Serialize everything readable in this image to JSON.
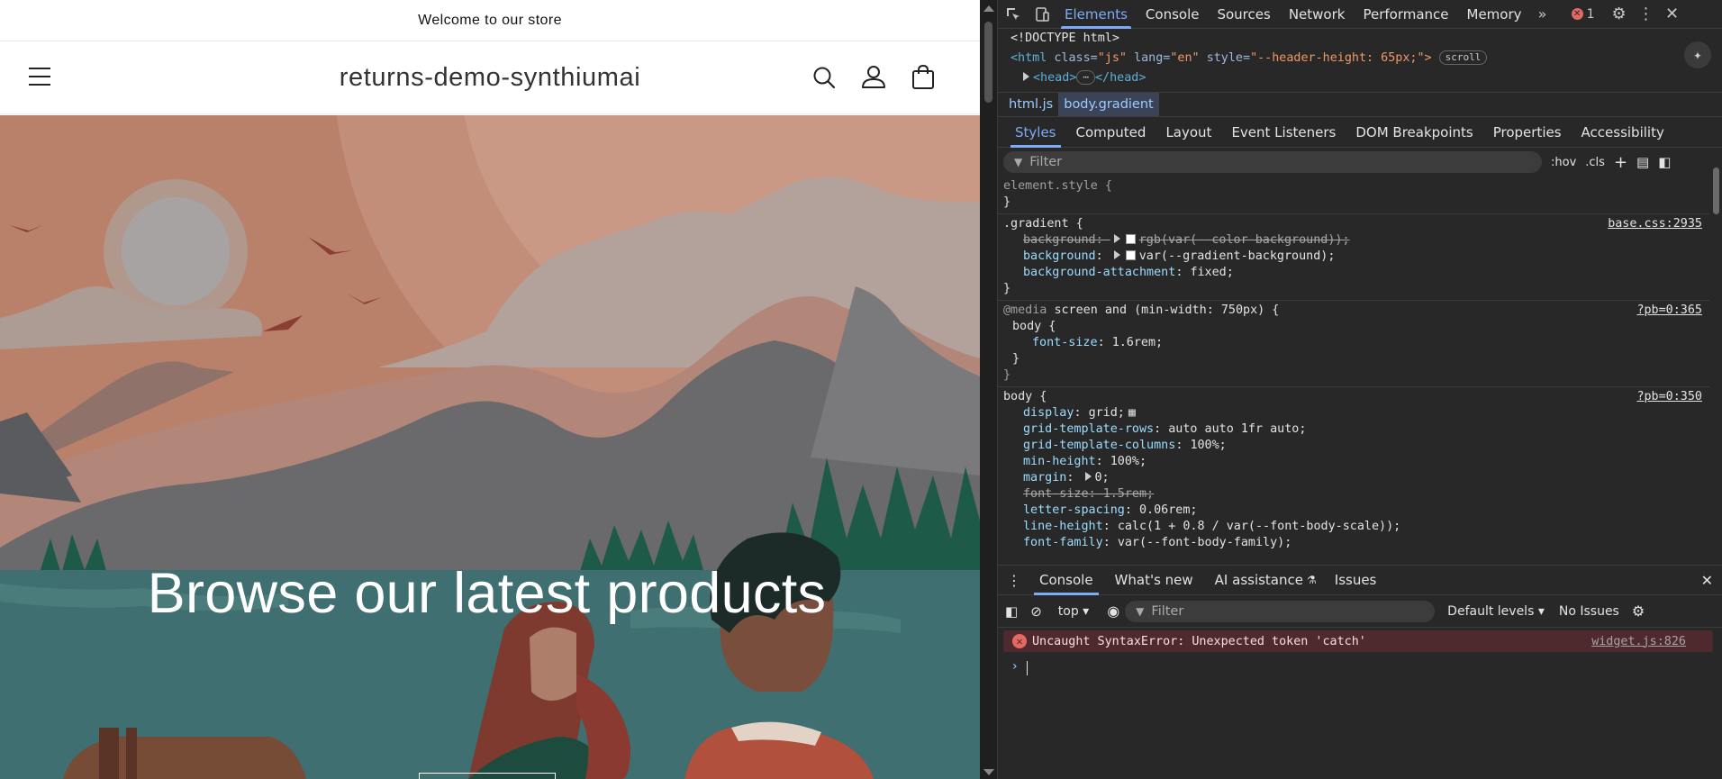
{
  "store": {
    "announcement": "Welcome to our store",
    "logo": "returns-demo-synthiumai",
    "headline": "Browse our latest products"
  },
  "devtools": {
    "tabs": [
      "Elements",
      "Console",
      "Sources",
      "Network",
      "Performance",
      "Memory"
    ],
    "active_tab": "Elements",
    "error_count": "1",
    "dom": {
      "doctype": "<!DOCTYPE html>",
      "html_tag": "<html",
      "html_attr_class": "class=",
      "html_val_class": "\"js\"",
      "html_attr_lang": "lang=",
      "html_val_lang": "\"en\"",
      "html_attr_style": "style=",
      "html_val_style": "\"--header-height: 65px;\">",
      "scroll_badge": "scroll",
      "head_open": "<head>",
      "head_close": "</head>"
    },
    "breadcrumbs": [
      "html.js",
      "body.gradient"
    ],
    "subtabs": [
      "Styles",
      "Computed",
      "Layout",
      "Event Listeners",
      "DOM Breakpoints",
      "Properties",
      "Accessibility"
    ],
    "filter_placeholder": "Filter",
    "hov": ":hov",
    "cls": ".cls",
    "rules": {
      "element_style": "element.style {",
      "close": "}",
      "gradient_sel": ".gradient {",
      "gradient_src": "base.css:2935",
      "g1_prop": "background",
      "g1_val": "rgb(var(--color-background));",
      "g2_prop": "background",
      "g2_val": "var(--gradient-background);",
      "g3_prop": "background-attachment",
      "g3_val": "fixed;",
      "media_kw": "@media",
      "media_q": "screen and (min-width: 750px) {",
      "media_src": "?pb=0:365",
      "body_sel": "body {",
      "m_prop": "font-size",
      "m_val": "1.6rem;",
      "body_src": "?pb=0:350",
      "b_props": [
        {
          "p": "display",
          "v": "grid;"
        },
        {
          "p": "grid-template-rows",
          "v": "auto auto 1fr auto;"
        },
        {
          "p": "grid-template-columns",
          "v": "100%;"
        },
        {
          "p": "min-height",
          "v": "100%;"
        },
        {
          "p": "margin",
          "v": "0;"
        },
        {
          "p": "font-size",
          "v": "1.5rem;"
        },
        {
          "p": "letter-spacing",
          "v": "0.06rem;"
        },
        {
          "p": "line-height",
          "v": "calc(1 + 0.8 / var(--font-body-scale));"
        },
        {
          "p": "font-family",
          "v": "var(--font-body-family);"
        }
      ]
    },
    "drawer_tabs": [
      "Console",
      "What's new",
      "AI assistance",
      "Issues"
    ],
    "console": {
      "context": "top",
      "filter_placeholder": "Filter",
      "levels": "Default levels",
      "issues": "No Issues",
      "error_message": "Uncaught SyntaxError: Unexpected token 'catch'",
      "error_source": "widget.js:826"
    }
  }
}
